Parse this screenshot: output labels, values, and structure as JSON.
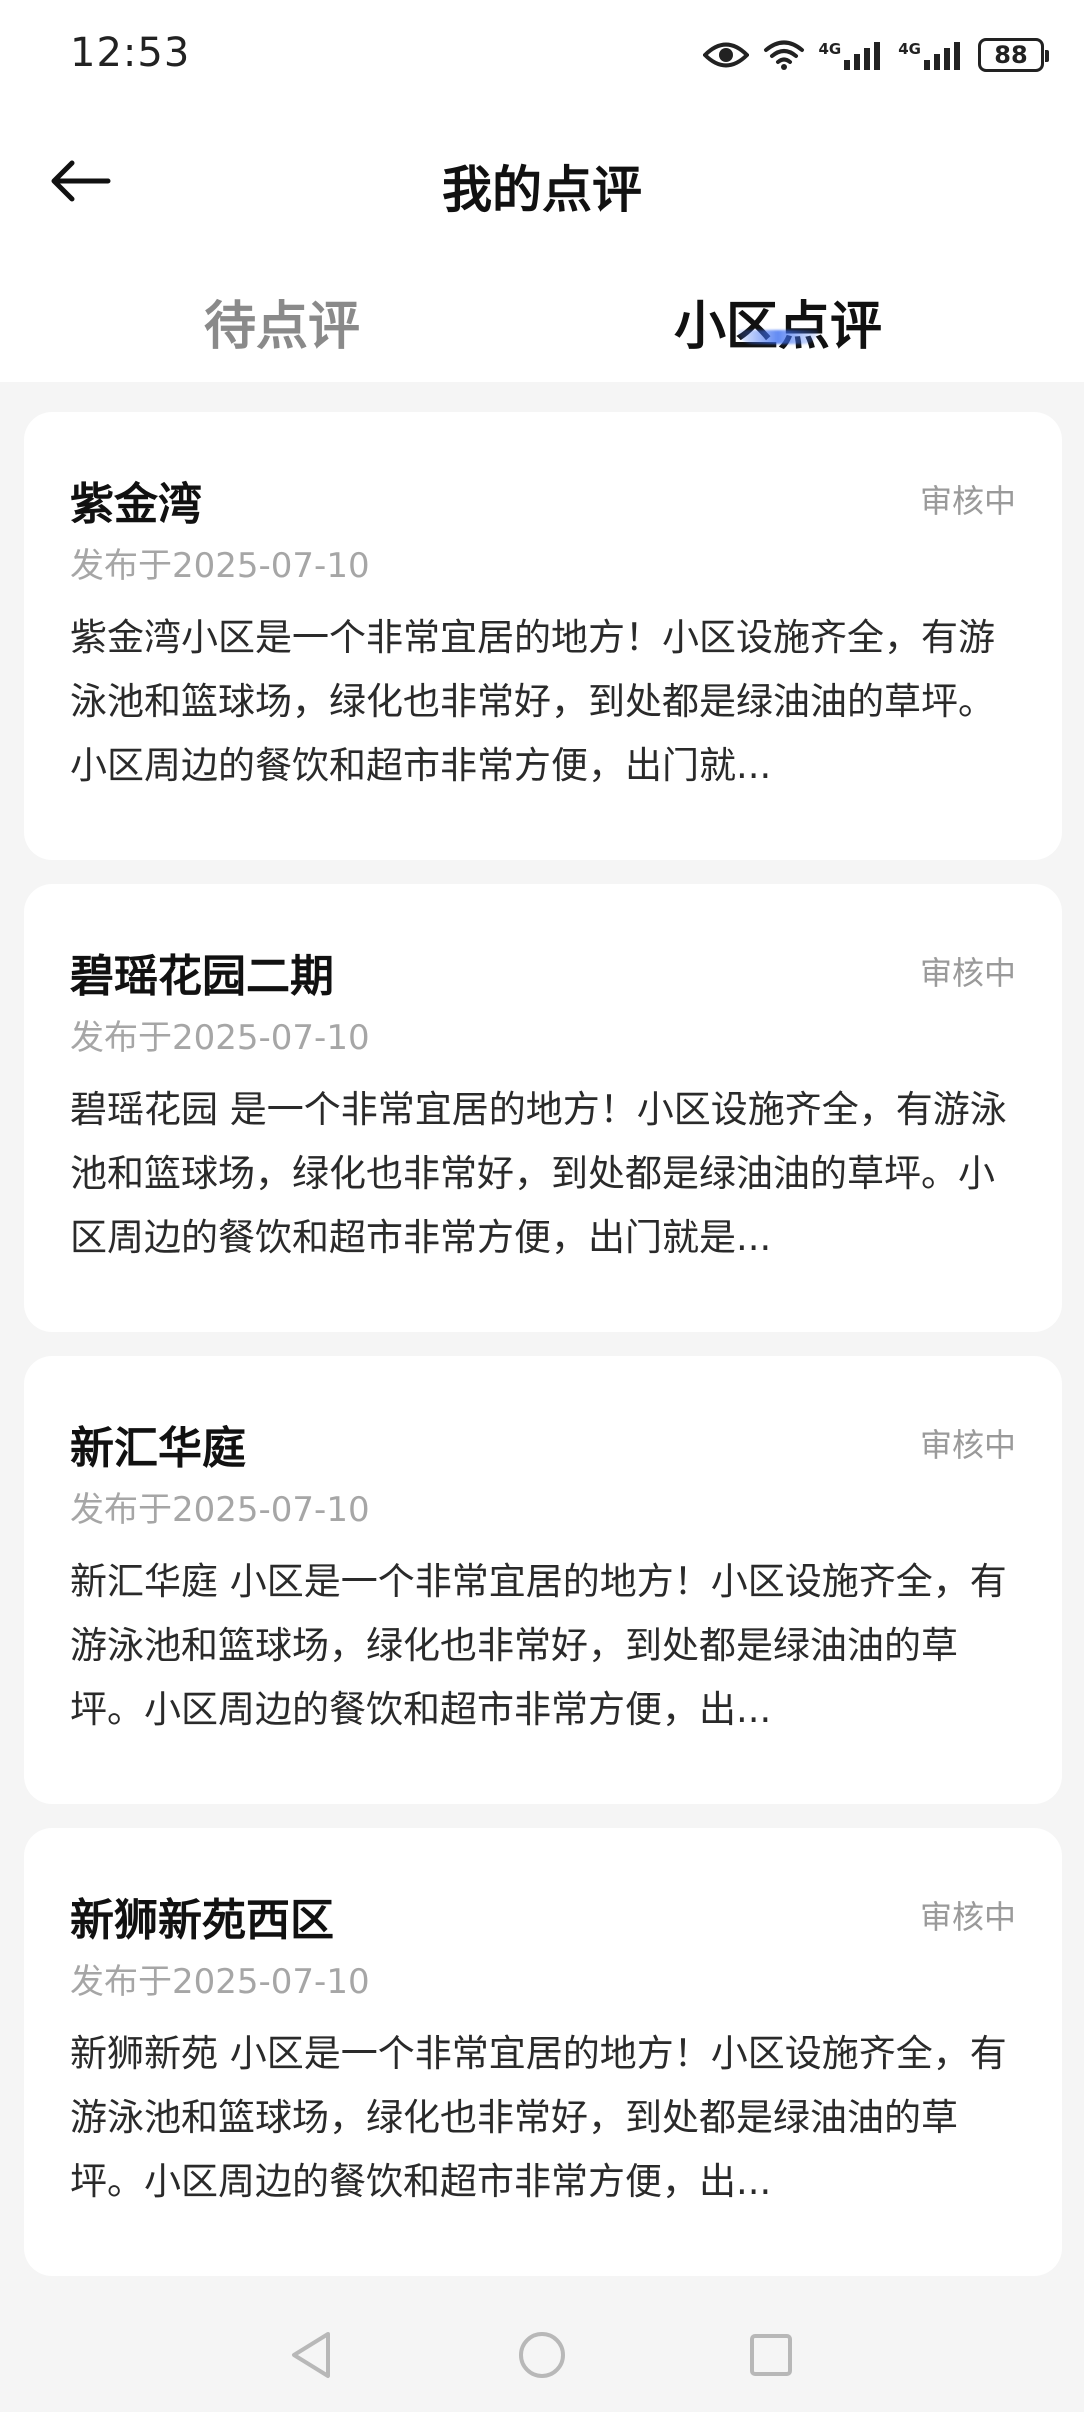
{
  "status_bar": {
    "time": "12:53",
    "icons": [
      "eye-icon",
      "wifi-icon",
      "signal-4g-icon",
      "signal-4g-icon"
    ],
    "network_label_1": "4G",
    "network_label_2": "4G",
    "battery": "88"
  },
  "header": {
    "title": "我的点评",
    "back_icon": "arrow-left-icon"
  },
  "tabs": [
    {
      "label": "待点评",
      "active": false
    },
    {
      "label": "小区点评",
      "active": true
    }
  ],
  "colors": {
    "background": "#f5f5f5",
    "card": "#ffffff",
    "active_tab_indicator": "#3c6ef0",
    "status_text": "#9a9a9a",
    "date_text": "#a6a6a6"
  },
  "reviews": [
    {
      "name": "紫金湾",
      "status": "审核中",
      "date": "发布于2025-07-10",
      "content": "紫金湾小区是一个非常宜居的地方！小区设施齐全，有游泳池和篮球场，绿化也非常好，到处都是绿油油的草坪。小区周边的餐饮和超市非常方便，出门就..."
    },
    {
      "name": "碧瑶花园二期",
      "status": "审核中",
      "date": "发布于2025-07-10",
      "content": "碧瑶花园 是一个非常宜居的地方！小区设施齐全，有游泳池和篮球场，绿化也非常好，到处都是绿油油的草坪。小区周边的餐饮和超市非常方便，出门就是..."
    },
    {
      "name": "新汇华庭",
      "status": "审核中",
      "date": "发布于2025-07-10",
      "content": "新汇华庭 小区是一个非常宜居的地方！小区设施齐全，有游泳池和篮球场，绿化也非常好，到处都是绿油油的草坪。小区周边的餐饮和超市非常方便，出..."
    },
    {
      "name": "新狮新苑西区",
      "status": "审核中",
      "date": "发布于2025-07-10",
      "content": "新狮新苑 小区是一个非常宜居的地方！小区设施齐全，有游泳池和篮球场，绿化也非常好，到处都是绿油油的草坪。小区周边的餐饮和超市非常方便，出..."
    }
  ],
  "nav_bar": {
    "icons": [
      "nav-back-icon",
      "nav-home-icon",
      "nav-recents-icon"
    ]
  }
}
